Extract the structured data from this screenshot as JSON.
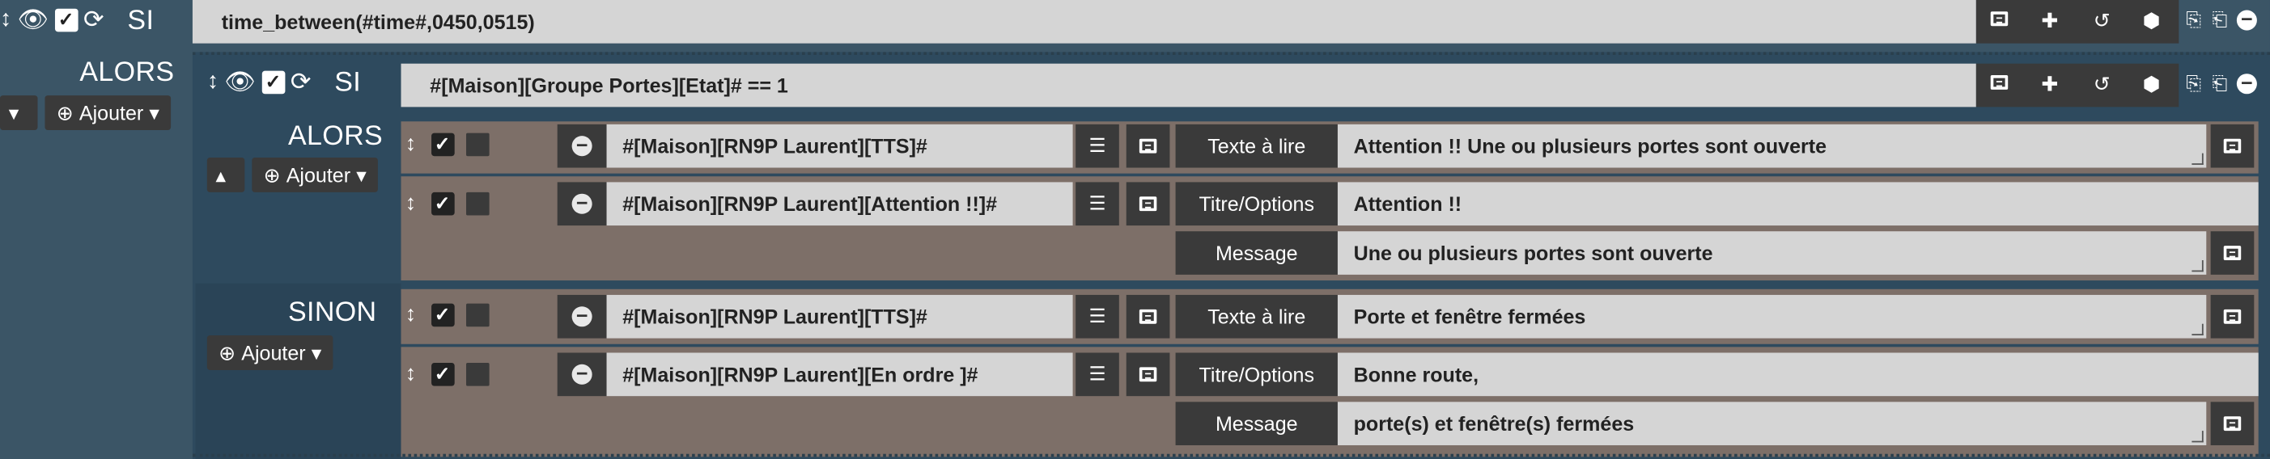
{
  "top": {
    "si_label": "SI",
    "condition": "time_between(#time#,0450,0515)",
    "alors_label": "ALORS",
    "ajouter_label": "Ajouter"
  },
  "nested": {
    "si_label": "SI",
    "condition": "#[Maison][Groupe Portes][Etat]# == 1",
    "alors_label": "ALORS",
    "ajouter_alors_label": "Ajouter",
    "sinon_label": "SINON",
    "ajouter_sinon_label": "Ajouter"
  },
  "actions": [
    {
      "command": "#[Maison][RN9P Laurent][TTS]#",
      "options": [
        {
          "label": "Texte à lire",
          "value": "Attention !! Une ou plusieurs portes sont ouverte"
        }
      ]
    },
    {
      "command": "#[Maison][RN9P Laurent][Attention !!]#",
      "options": [
        {
          "label": "Titre/Options",
          "value": "Attention !!"
        },
        {
          "label": "Message",
          "value": "Une ou plusieurs portes sont ouverte"
        }
      ]
    },
    {
      "command": "#[Maison][RN9P Laurent][TTS]#",
      "options": [
        {
          "label": "Texte à lire",
          "value": "Porte et fenêtre fermées"
        }
      ]
    },
    {
      "command": "#[Maison][RN9P Laurent][En ordre ]#",
      "options": [
        {
          "label": "Titre/Options",
          "value": "Bonne route,"
        },
        {
          "label": "Message",
          "value": "porte(s) et fenêtre(s) fermées"
        }
      ]
    }
  ],
  "colors": {
    "background": "#3b5566",
    "action_row": "#7d6f68",
    "field": "#d5d5d5",
    "dark_button": "#3a3a3a"
  }
}
